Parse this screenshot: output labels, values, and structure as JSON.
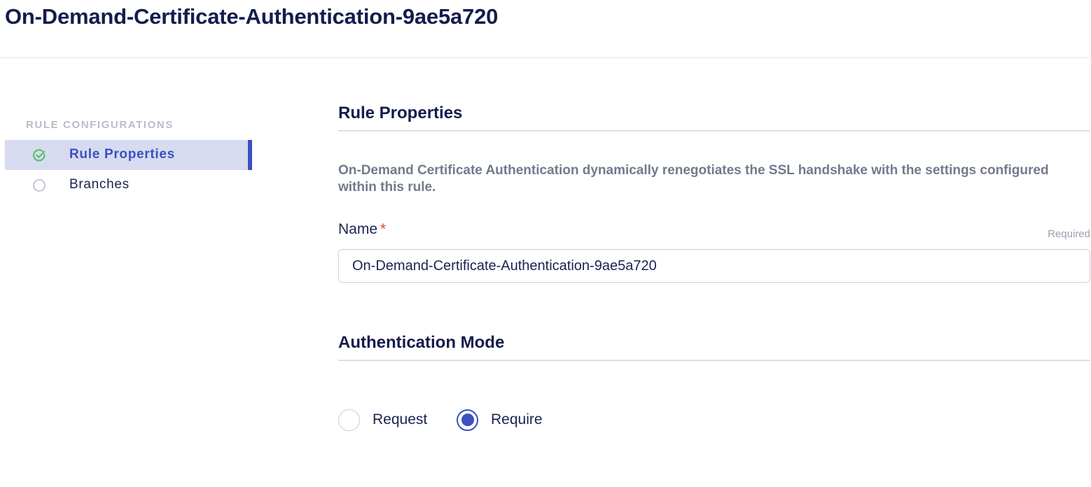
{
  "page": {
    "title": "On-Demand-Certificate-Authentication-9ae5a720"
  },
  "sidebar": {
    "heading": "RULE CONFIGURATIONS",
    "items": [
      {
        "label": "Rule Properties",
        "state": "complete",
        "active": true,
        "icon": "check-circle-icon"
      },
      {
        "label": "Branches",
        "state": "incomplete",
        "active": false,
        "icon": "empty-circle-icon"
      }
    ]
  },
  "rule_properties": {
    "heading": "Rule Properties",
    "description": "On-Demand Certificate Authentication dynamically renegotiates the SSL handshake with the settings configured within this rule.",
    "name_field": {
      "label": "Name",
      "required_mark": "*",
      "required_hint": "Required",
      "value": "On-Demand-Certificate-Authentication-9ae5a720"
    }
  },
  "authentication_mode": {
    "heading": "Authentication Mode",
    "options": [
      {
        "label": "Request",
        "checked": false
      },
      {
        "label": "Require",
        "checked": true
      }
    ]
  },
  "colors": {
    "accent": "#3d4fc2",
    "title": "#141c4d",
    "success_icon": "#4cc25e",
    "required_star": "#e0432f",
    "active_item_bg": "#d7dbef"
  }
}
